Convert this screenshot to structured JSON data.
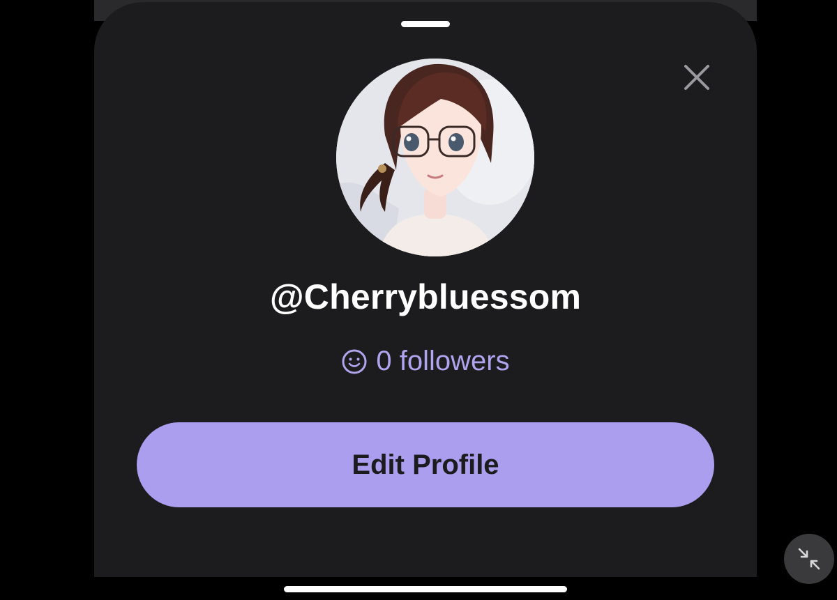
{
  "profile": {
    "username": "@Cherrybluessom",
    "followers_text": "0 followers",
    "avatar_alt": "avatar"
  },
  "actions": {
    "edit_profile_label": "Edit Profile"
  },
  "icons": {
    "close": "close-icon",
    "followers": "smiley-icon",
    "minimize": "minimize-arrows-icon"
  },
  "colors": {
    "sheet_background": "#1c1c1e",
    "accent": "#ab9eef",
    "followers_text": "#b0a4ef",
    "text_primary": "#ffffff"
  }
}
